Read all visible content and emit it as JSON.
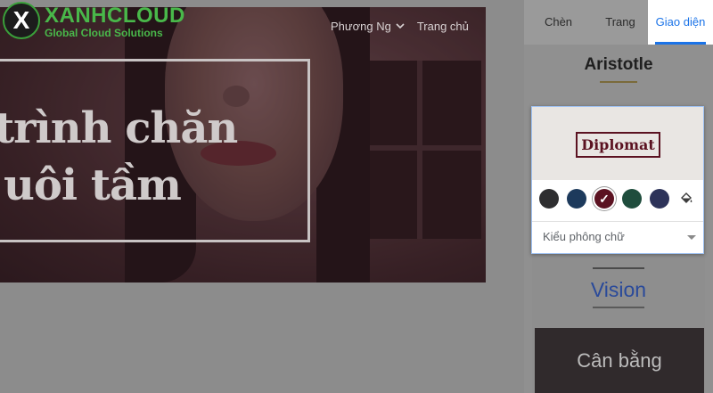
{
  "logo": {
    "mark": "X",
    "name": "XANHCLOUD",
    "tagline": "Global Cloud Solutions"
  },
  "site_nav": {
    "user": "Phương Ng",
    "home": "Trang chủ",
    "user_icon": "chevron-down-icon"
  },
  "hero": {
    "line1": "trình chăn",
    "line2": "uôi tầm"
  },
  "tabs": [
    {
      "label": "Chèn"
    },
    {
      "label": "Trang"
    },
    {
      "label": "Giao diện",
      "active": true
    }
  ],
  "themes": {
    "aristotle": "Aristotle",
    "diplomat": {
      "name": "Diplomat",
      "colors": [
        "#2e2e30",
        "#1d3a5c",
        "#5b1221",
        "#1f4d3d",
        "#2d3359"
      ],
      "selected_color": "#5b1221",
      "custom_color_icon": "paint-bucket-icon",
      "font_select_label": "Kiểu phông chữ"
    },
    "vision": "Vision",
    "balance": "Cân bằng"
  }
}
